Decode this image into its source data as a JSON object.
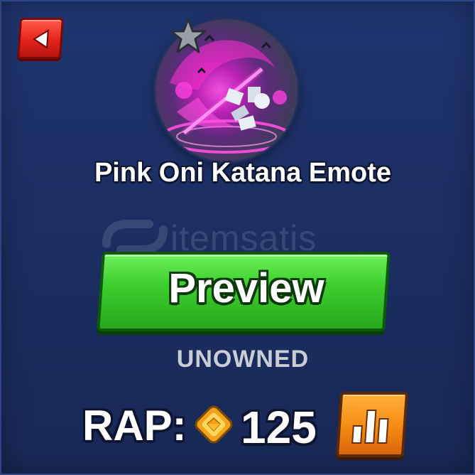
{
  "item": {
    "name": "Pink Oni Katana Emote",
    "status": "UNOWNED"
  },
  "actions": {
    "preview_label": "Preview"
  },
  "rap": {
    "label": "RAP:",
    "value": "125"
  },
  "watermark": {
    "text": "itemsatis"
  },
  "icons": {
    "back": "back-arrow-icon",
    "rarity": "star-icon",
    "currency": "diamond-coin-icon",
    "chart": "bar-chart-icon"
  },
  "colors": {
    "background": "#1c2f63",
    "back_button": "#e3241c",
    "preview_button": "#3fcf2f",
    "chart_button": "#f58a12",
    "status_text": "#c9cdd6",
    "orb_glow": "#ff50e6"
  }
}
